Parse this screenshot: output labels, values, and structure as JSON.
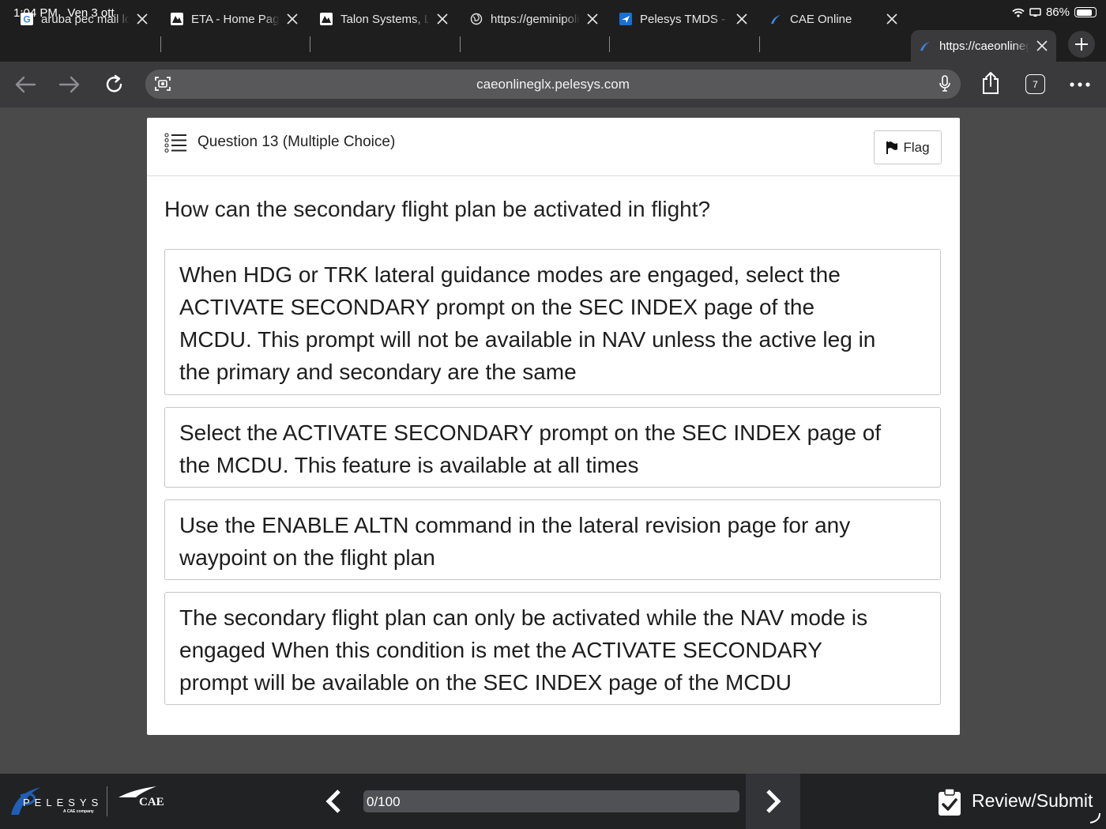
{
  "status_bar": {
    "time": "1:04 PM",
    "date": "Ven 3 ott",
    "battery": "86%",
    "battery_level": 0.86
  },
  "tabs": [
    {
      "title": "aruba pec mail login",
      "icon": "google-g-icon"
    },
    {
      "title": "ETA - Home Page",
      "icon": "eta-logo-icon"
    },
    {
      "title": "Talon Systems, LLC",
      "icon": "talon-logo-icon"
    },
    {
      "title": "https://geminipolis",
      "icon": "globe-icon"
    },
    {
      "title": "Pelesys TMDS - Login",
      "icon": "plane-icon"
    },
    {
      "title": "CAE Online",
      "icon": "pelesys-swoosh-icon"
    },
    {
      "title": "https://caeonlineglx",
      "icon": "pelesys-swoosh-icon",
      "active": true
    }
  ],
  "toolbar": {
    "url": "caeonlineglx.pelesys.com",
    "tab_count": "7"
  },
  "question": {
    "header": "Question 13 (Multiple Choice)",
    "flag_label": "Flag",
    "text": "How can the secondary flight plan be activated in flight?",
    "options": [
      "When HDG or TRK lateral guidance modes are engaged, select the ACTIVATE SECONDARY prompt on the SEC INDEX page of the MCDU. This prompt will not be available in NAV unless the active leg in the primary and secondary are the same",
      "Select the ACTIVATE SECONDARY prompt on the SEC INDEX page of the MCDU. This feature is available at all times",
      "Use the ENABLE ALTN command in the lateral revision page for any waypoint on the flight plan",
      "The secondary flight plan can only be activated while the NAV mode is engaged When this condition is met the ACTIVATE SECONDARY prompt will be available on the SEC INDEX page of the MCDU"
    ]
  },
  "footer": {
    "brand": "PELESYS",
    "brand_tagline": "A CAE company",
    "partner": "CAE",
    "progress_text": "0/100",
    "progress_value": 0,
    "review_label": "Review/Submit"
  },
  "colors": {
    "background": "#4a4a4a",
    "chrome": "#1e1e1f",
    "toolbar": "#3a3a3c",
    "footer": "#212224",
    "pelesys_blue": "#1f5fb8"
  }
}
